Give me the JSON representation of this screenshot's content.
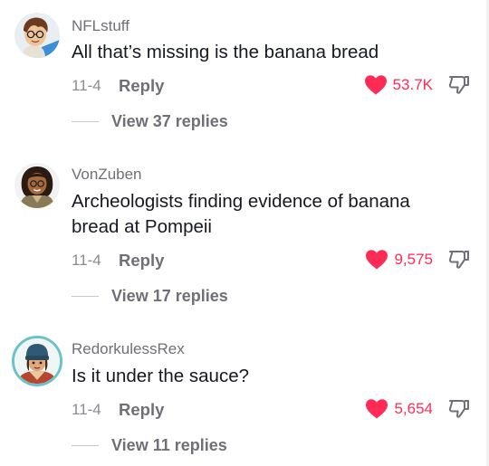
{
  "colors": {
    "like_red": "#fe2c55",
    "username_gray": "#6f7077",
    "text_dark": "#161823"
  },
  "comments": [
    {
      "username": "NFLstuff",
      "text": "All that’s missing is the banana bread",
      "date": "11-4",
      "reply_label": "Reply",
      "likes": "53.7K",
      "view_replies": "View 37 replies",
      "avatar_icon": "cartoon-boy-avatar",
      "liked": true
    },
    {
      "username": "VonZuben",
      "text": "Archeologists finding evidence of banana bread at Pompeii",
      "date": "11-4",
      "reply_label": "Reply",
      "likes": "9,575",
      "view_replies": "View 17 replies",
      "avatar_icon": "cartoon-girl-avatar",
      "liked": true
    },
    {
      "username": "RedorkulessRex",
      "text": "Is it under the sauce?",
      "date": "11-4",
      "reply_label": "Reply",
      "likes": "5,654",
      "view_replies": "View 11 replies",
      "avatar_icon": "cartoon-beanie-avatar",
      "liked": true
    }
  ]
}
